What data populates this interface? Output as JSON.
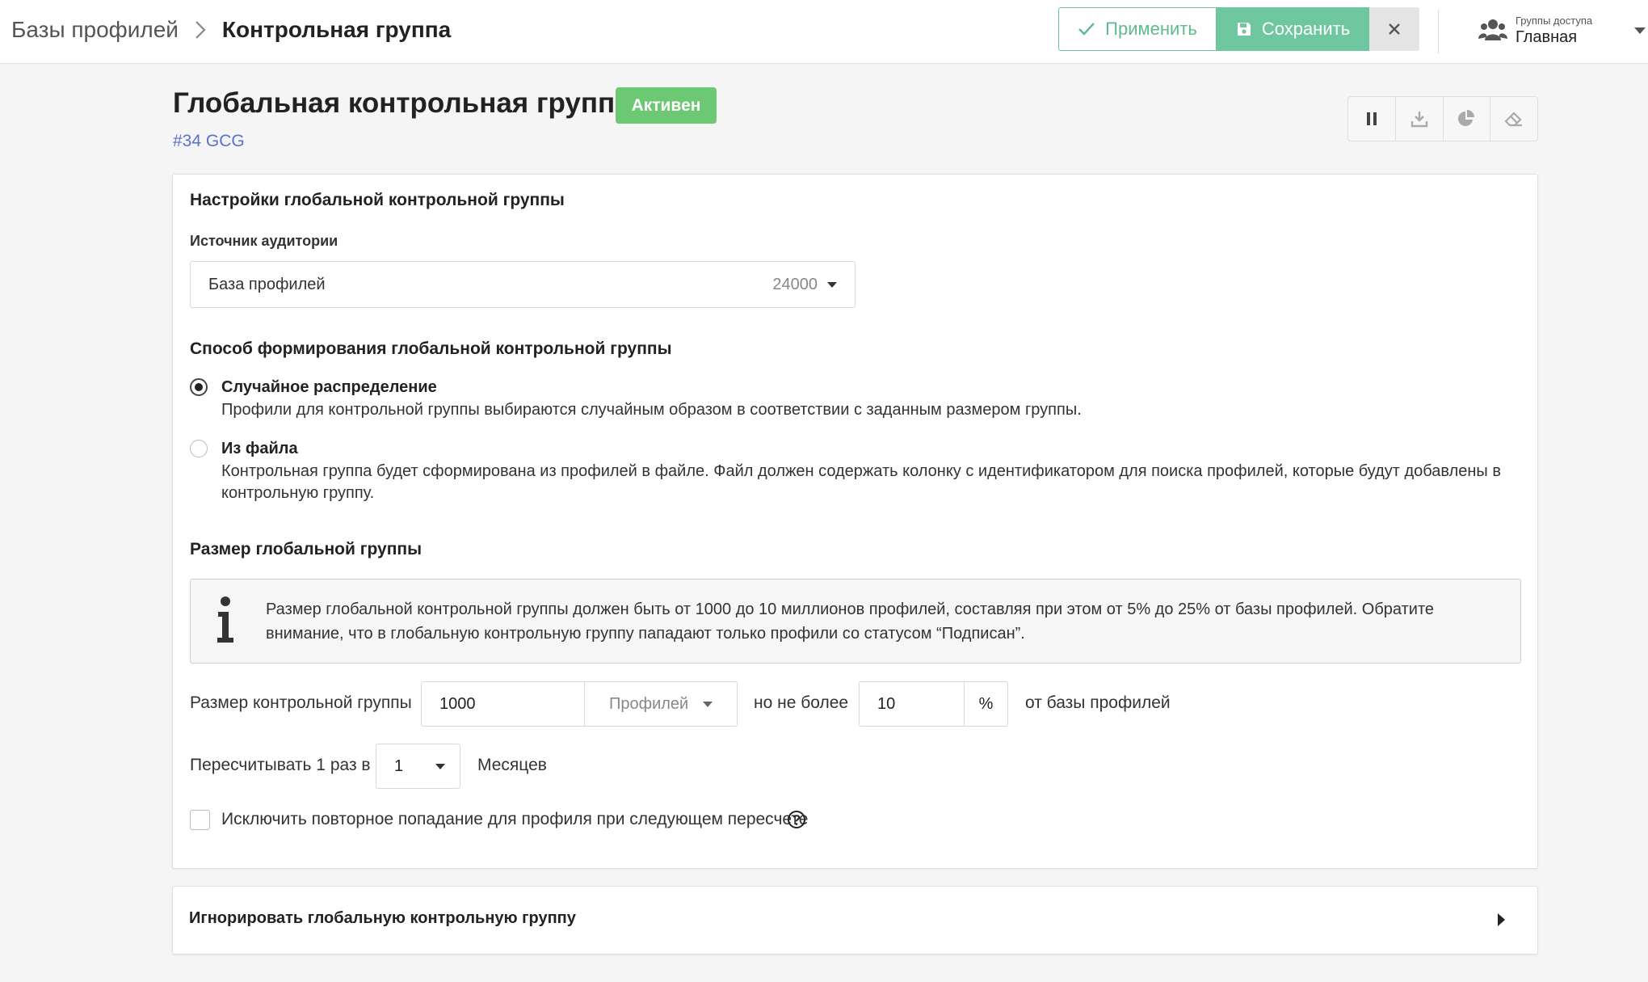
{
  "breadcrumb": {
    "root": "Базы профилей",
    "current": "Контрольная группа"
  },
  "toolbar": {
    "apply_label": "Применить",
    "save_label": "Сохранить"
  },
  "access_group": {
    "label": "Группы доступа",
    "value": "Главная"
  },
  "header": {
    "title": "Глобальная контрольная группа",
    "status": "Активен",
    "id": "#34 GCG"
  },
  "settings": {
    "section_title": "Настройки глобальной контрольной группы",
    "source_label": "Источник аудитории",
    "source_value": "База профилей",
    "source_count": "24000",
    "method_title": "Способ формирования глобальной контрольной группы",
    "options": [
      {
        "title": "Случайное распределение",
        "description": "Профили для контрольной группы выбираются случайным образом в соответствии с заданным размером группы.",
        "selected": true
      },
      {
        "title": "Из файла",
        "description": "Контрольная группа будет сформирована из профилей в файле. Файл должен содержать колонку с идентификатором для поиска профилей, которые будут добавлены в контрольную группу.",
        "selected": false
      }
    ],
    "size_title": "Размер глобальной группы",
    "info_text": "Размер глобальной контрольной группы должен быть от 1000 до 10 миллионов профилей, составляя при этом от 5% до 25% от базы профилей. Обратите внимание, что в глобальную контрольную группу пападают только профили со статусом “Подписан”.",
    "size_row": {
      "label": "Размер контрольной группы",
      "value": "1000",
      "unit": "Профилей",
      "max_label": "но не более",
      "max_value": "10",
      "percent": "%",
      "suffix": "от базы профилей"
    },
    "recalc_row": {
      "label": "Пересчитывать 1 раз в",
      "value": "1",
      "unit": "Месяцев"
    },
    "exclude_label": "Исключить повторное попадание для профиля при следующем пересчете",
    "exclude_checked": false
  },
  "ignore_section": {
    "title": "Игнорировать глобальную контрольную группу"
  },
  "colors": {
    "accent_green": "#6fc7a0",
    "badge_green": "#6cc873",
    "id_blue": "#5a73c8"
  }
}
